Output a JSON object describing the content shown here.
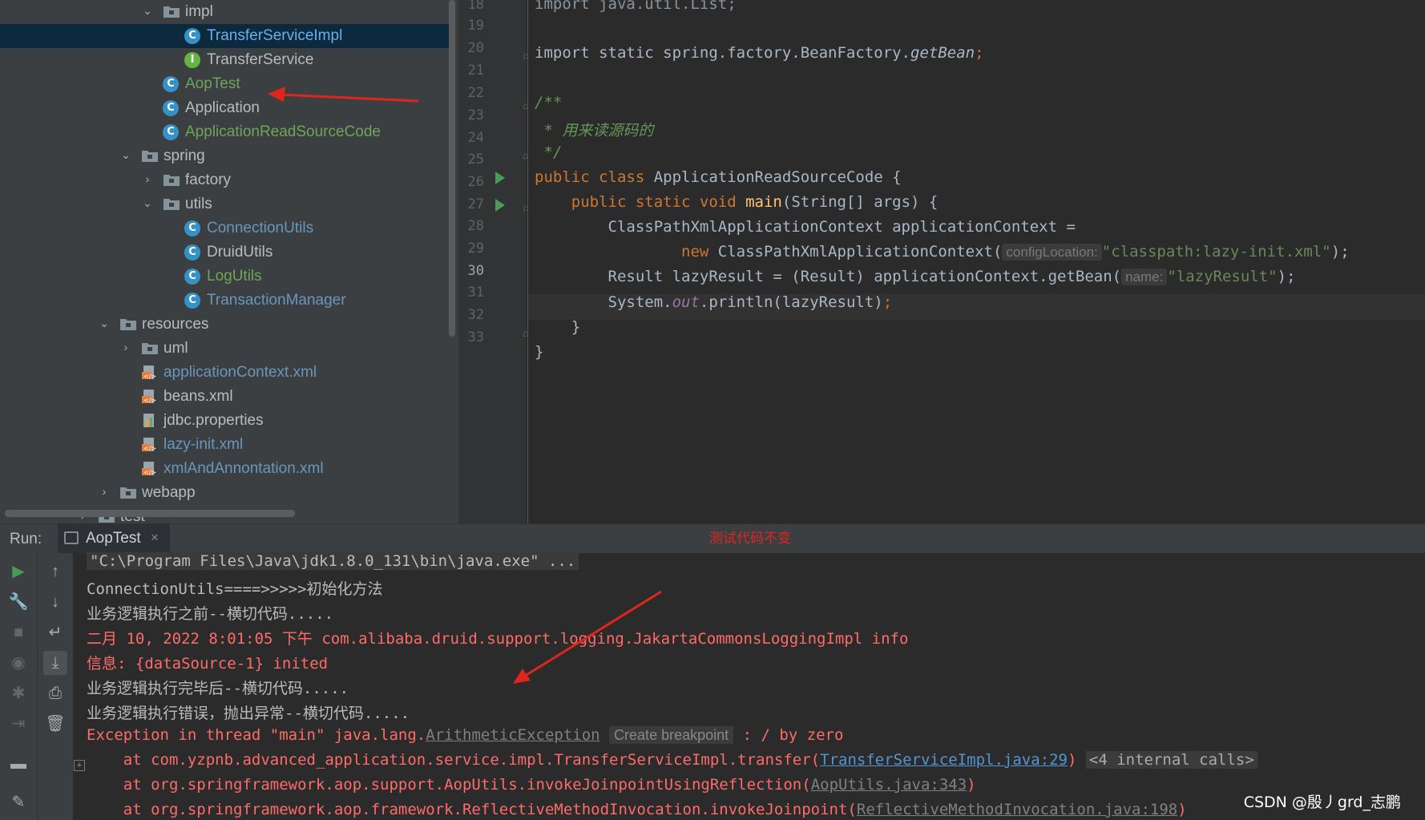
{
  "project_tree": {
    "items": [
      {
        "label": "impl",
        "kind": "folder",
        "color": "normal",
        "indent": 1,
        "expanded": true
      },
      {
        "label": "TransferServiceImpl",
        "kind": "class",
        "color": "selected",
        "indent": 2
      },
      {
        "label": "TransferService",
        "kind": "interface",
        "color": "normal",
        "indent": 2
      },
      {
        "label": "AopTest",
        "kind": "class",
        "color": "green",
        "indent": 1
      },
      {
        "label": "Application",
        "kind": "class",
        "color": "normal",
        "indent": 1
      },
      {
        "label": "ApplicationReadSourceCode",
        "kind": "class",
        "color": "green",
        "indent": 1
      },
      {
        "label": "spring",
        "kind": "folder",
        "color": "normal",
        "indent": 0,
        "expanded": true
      },
      {
        "label": "factory",
        "kind": "folder",
        "color": "normal",
        "indent": 1,
        "expanded": false
      },
      {
        "label": "utils",
        "kind": "folder",
        "color": "normal",
        "indent": 1,
        "expanded": true
      },
      {
        "label": "ConnectionUtils",
        "kind": "class",
        "color": "blue",
        "indent": 2
      },
      {
        "label": "DruidUtils",
        "kind": "class",
        "color": "normal",
        "indent": 2
      },
      {
        "label": "LogUtils",
        "kind": "class",
        "color": "green",
        "indent": 2
      },
      {
        "label": "TransactionManager",
        "kind": "class",
        "color": "blue",
        "indent": 2
      },
      {
        "label": "resources",
        "kind": "folder",
        "color": "normal",
        "indent": -1,
        "expanded": true
      },
      {
        "label": "uml",
        "kind": "folder",
        "color": "normal",
        "indent": 0,
        "expanded": false
      },
      {
        "label": "applicationContext.xml",
        "kind": "xml",
        "color": "blue",
        "indent": 0
      },
      {
        "label": "beans.xml",
        "kind": "xml",
        "color": "normal",
        "indent": 0
      },
      {
        "label": "jdbc.properties",
        "kind": "props",
        "color": "normal",
        "indent": 0
      },
      {
        "label": "lazy-init.xml",
        "kind": "xml",
        "color": "blue",
        "indent": 0
      },
      {
        "label": "xmlAndAnnontation.xml",
        "kind": "xml",
        "color": "blue",
        "indent": 0
      },
      {
        "label": "webapp",
        "kind": "folder",
        "color": "normal",
        "indent": -1,
        "expanded": false
      },
      {
        "label": "test",
        "kind": "folder",
        "color": "normal",
        "indent": -2,
        "expanded": false
      }
    ]
  },
  "editor": {
    "line_numbers": [
      "18",
      "19",
      "20",
      "21",
      "22",
      "23",
      "24",
      "25",
      "26",
      "27",
      "28",
      "29",
      "30",
      "31",
      "32",
      "33"
    ],
    "current_line": "30",
    "lines": {
      "l18": "import java.util.List;",
      "l20a": "import static spring.factory.BeanFactory.",
      "l20b": "getBean",
      "l20c": ";",
      "l22": "/**",
      "l23a": " * ",
      "l23b": "用来读源码的",
      "l24": " */",
      "l25a": "public class ",
      "l25b": "ApplicationReadSourceCode {",
      "l26a": "    public static void ",
      "l26b": "main",
      "l26c": "(String[] args) {",
      "l27": "        ClassPathXmlApplicationContext applicationContext =",
      "l28a": "                new ",
      "l28b": "ClassPathXmlApplicationContext(",
      "l28hint": "configLocation:",
      "l28c": "\"classpath:lazy-init.xml\"",
      "l28d": ");",
      "l29a": "        Result lazyResult = (Result) applicationContext.getBean(",
      "l29hint": "name:",
      "l29c": "\"lazyResult\"",
      "l29d": ");",
      "l30a": "        System.",
      "l30b": "out",
      "l30c": ".println(lazyResult)",
      "l30d": ";",
      "l31": "    }",
      "l32": "}"
    }
  },
  "run_window": {
    "label": "Run:",
    "tab": "AopTest",
    "tab_close": "×",
    "annotation": "测试代码不变",
    "console": {
      "c1": "\"C:\\Program Files\\Java\\jdk1.8.0_131\\bin\\java.exe\" ...",
      "c2": "ConnectionUtils====>>>>>初始化方法",
      "c3": "业务逻辑执行之前--横切代码.....",
      "c4": "二月 10, 2022 8:01:05 下午 com.alibaba.druid.support.logging.JakartaCommonsLoggingImpl info",
      "c5": "信息: {dataSource-1} inited",
      "c6": "业务逻辑执行完毕后--横切代码.....",
      "c7": "业务逻辑执行错误，抛出异常--横切代码.....",
      "c8a": "Exception in thread \"main\" java.lang.",
      "c8b": "ArithmeticException",
      "c8c": "Create breakpoint",
      "c8d": " : / by zero",
      "c9a": "    at com.yzpnb.advanced_application.service.impl.TransferServiceImpl.transfer(",
      "c9b": "TransferServiceImpl.java:29",
      "c9c": ")",
      "c9d": "<4 internal calls>",
      "c10a": "    at org.springframework.aop.support.AopUtils.invokeJoinpointUsingReflection(",
      "c10b": "AopUtils.java:343",
      "c10c": ")",
      "c11a": "    at org.springframework.aop.framework.ReflectiveMethodInvocation.invokeJoinpoint(",
      "c11b": "ReflectiveMethodInvocation.java:198",
      "c11c": ")"
    }
  },
  "watermark": "CSDN @殷丿grd_志鹏",
  "colors": {
    "annotation_arrow": "#e0261c",
    "keyword": "#cc7832",
    "string": "#6a8759",
    "selection": "#0d293e"
  }
}
